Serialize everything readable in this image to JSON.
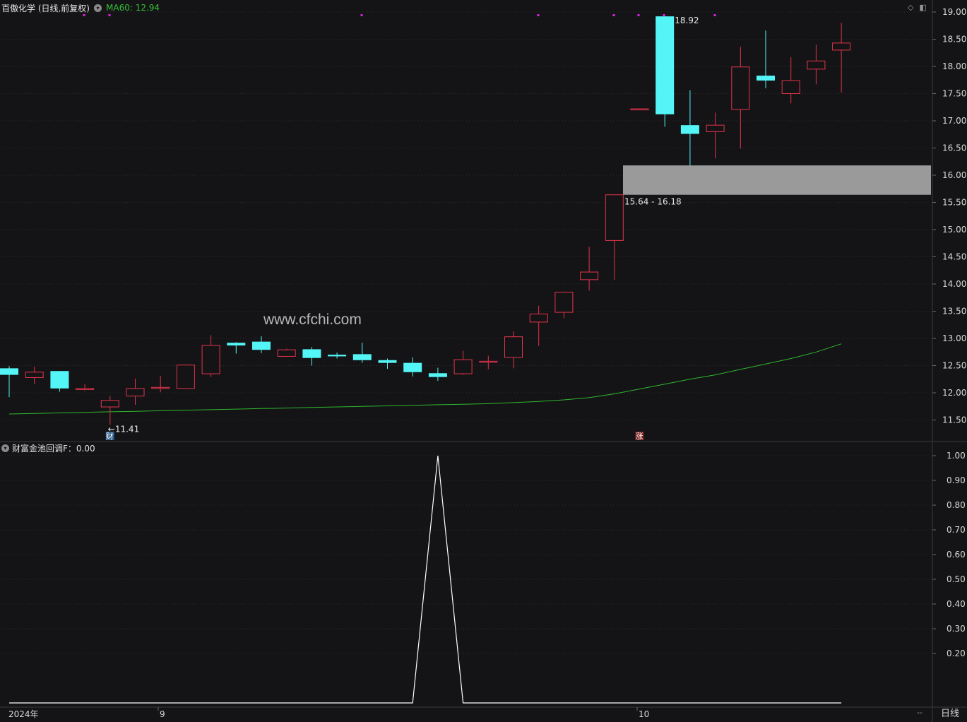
{
  "header": {
    "stock_title": "百傲化学 (日线,前复权)",
    "ma_label": "MA60: 12.94",
    "toggle_icon": "chevron-down-icon",
    "top_icons": [
      "diamond-icon",
      "panel-toggle-icon"
    ]
  },
  "watermark": "www.cfchi.com",
  "indicator": {
    "label": "财富金池回调F：0.00"
  },
  "footer": {
    "period": "日线",
    "dash": "--",
    "x_labels": [
      "2024年",
      "9",
      "10"
    ]
  },
  "colors": {
    "background": "#141416",
    "up": "#e2344b",
    "down": "#54f5f7",
    "ma": "#2fb62f",
    "grid": "#2e2e30",
    "zone": "#9a9a9a",
    "text": "#d8d8d8",
    "marker_magenta": "#e020e0",
    "signal_line": "#ffffff"
  },
  "chart_data": [
    {
      "type": "candlestick",
      "title": "百傲化学 (日线,前复权)",
      "ylim": [
        11.2,
        19.1
      ],
      "y_ticks": [
        19.0,
        18.5,
        18.0,
        17.5,
        17.0,
        16.5,
        16.0,
        15.5,
        15.0,
        14.5,
        14.0,
        13.5,
        13.0,
        12.5,
        12.0,
        11.5
      ],
      "y_tick_labels": [
        "19.00",
        "18.50",
        "18.00",
        "17.50",
        "17.00",
        "16.50",
        "16.00",
        "15.50",
        "15.00",
        "14.50",
        "14.00",
        "13.50",
        "13.00",
        "12.50",
        "12.00",
        "11.50"
      ],
      "candles": [
        {
          "o": 12.45,
          "h": 12.49,
          "l": 11.92,
          "c": 12.33
        },
        {
          "o": 12.28,
          "h": 12.48,
          "l": 12.16,
          "c": 12.38
        },
        {
          "o": 12.4,
          "h": 12.4,
          "l": 12.02,
          "c": 12.08
        },
        {
          "o": 12.06,
          "h": 12.16,
          "l": 12.04,
          "c": 12.08
        },
        {
          "o": 11.74,
          "h": 11.94,
          "l": 11.41,
          "c": 11.86
        },
        {
          "o": 11.94,
          "h": 12.26,
          "l": 11.78,
          "c": 12.08
        },
        {
          "o": 12.08,
          "h": 12.31,
          "l": 12.01,
          "c": 12.1
        },
        {
          "o": 12.08,
          "h": 12.52,
          "l": 12.08,
          "c": 12.51
        },
        {
          "o": 12.35,
          "h": 13.06,
          "l": 12.29,
          "c": 12.87
        },
        {
          "o": 12.92,
          "h": 12.93,
          "l": 12.72,
          "c": 12.87
        },
        {
          "o": 12.94,
          "h": 13.04,
          "l": 12.73,
          "c": 12.79
        },
        {
          "o": 12.67,
          "h": 12.81,
          "l": 12.66,
          "c": 12.79
        },
        {
          "o": 12.8,
          "h": 12.84,
          "l": 12.5,
          "c": 12.64
        },
        {
          "o": 12.7,
          "h": 12.74,
          "l": 12.63,
          "c": 12.67
        },
        {
          "o": 12.71,
          "h": 12.92,
          "l": 12.55,
          "c": 12.6
        },
        {
          "o": 12.6,
          "h": 12.63,
          "l": 12.44,
          "c": 12.55
        },
        {
          "o": 12.55,
          "h": 12.65,
          "l": 12.3,
          "c": 12.38
        },
        {
          "o": 12.36,
          "h": 12.46,
          "l": 12.22,
          "c": 12.29
        },
        {
          "o": 12.35,
          "h": 12.77,
          "l": 12.33,
          "c": 12.61
        },
        {
          "o": 12.58,
          "h": 12.68,
          "l": 12.43,
          "c": 12.58
        },
        {
          "o": 12.65,
          "h": 13.13,
          "l": 12.45,
          "c": 13.03
        },
        {
          "o": 13.3,
          "h": 13.6,
          "l": 12.86,
          "c": 13.45
        },
        {
          "o": 13.48,
          "h": 13.86,
          "l": 13.37,
          "c": 13.85
        },
        {
          "o": 14.08,
          "h": 14.68,
          "l": 13.88,
          "c": 14.22
        },
        {
          "o": 14.8,
          "h": 15.64,
          "l": 14.08,
          "c": 15.64
        },
        {
          "o": 17.22,
          "h": 17.22,
          "l": 17.22,
          "c": 17.22
        },
        {
          "o": 18.92,
          "h": 18.92,
          "l": 16.89,
          "c": 17.12
        },
        {
          "o": 16.92,
          "h": 17.56,
          "l": 16.18,
          "c": 16.76
        },
        {
          "o": 16.8,
          "h": 17.15,
          "l": 16.31,
          "c": 16.92
        },
        {
          "o": 17.21,
          "h": 18.36,
          "l": 16.49,
          "c": 17.99
        },
        {
          "o": 17.83,
          "h": 18.66,
          "l": 17.6,
          "c": 17.74
        },
        {
          "o": 17.5,
          "h": 18.17,
          "l": 17.32,
          "c": 17.74
        },
        {
          "o": 17.95,
          "h": 18.4,
          "l": 17.67,
          "c": 18.1
        },
        {
          "o": 18.3,
          "h": 18.8,
          "l": 17.52,
          "c": 18.43
        }
      ],
      "ma60": {
        "name": "MA60",
        "values": [
          11.61,
          11.62,
          11.63,
          11.64,
          11.65,
          11.66,
          11.67,
          11.68,
          11.69,
          11.7,
          11.71,
          11.72,
          11.73,
          11.74,
          11.75,
          11.76,
          11.77,
          11.78,
          11.79,
          11.8,
          11.82,
          11.84,
          11.87,
          11.91,
          11.98,
          12.07,
          12.16,
          12.25,
          12.33,
          12.43,
          12.53,
          12.63,
          12.75,
          12.9
        ]
      },
      "gap_zone": {
        "low": 15.64,
        "high": 16.18,
        "label": "15.64 - 16.18"
      },
      "annotations": [
        {
          "text": "18.92",
          "value": 18.92
        },
        {
          "text": "←11.41",
          "value": 11.41
        }
      ],
      "event_markers": [
        {
          "text": "财",
          "index": 4
        },
        {
          "text": "涨",
          "index": 25
        }
      ],
      "signal_dots_count": 8
    },
    {
      "type": "line",
      "title": "财富金池回调F：0.00",
      "ylim": [
        0,
        1.05
      ],
      "y_ticks": [
        1.0,
        0.9,
        0.8,
        0.7,
        0.6,
        0.5,
        0.4,
        0.3,
        0.2
      ],
      "y_tick_labels": [
        "1.00",
        "0.90",
        "0.80",
        "0.70",
        "0.60",
        "0.50",
        "0.40",
        "0.30",
        "0.20"
      ],
      "series": [
        {
          "values": [
            0,
            0,
            0,
            0,
            0,
            0,
            0,
            0,
            0,
            0,
            0,
            0,
            0,
            0,
            0,
            0,
            0,
            1,
            0,
            0,
            0,
            0,
            0,
            0,
            0,
            0,
            0,
            0,
            0,
            0,
            0,
            0,
            0,
            0
          ]
        }
      ]
    }
  ]
}
